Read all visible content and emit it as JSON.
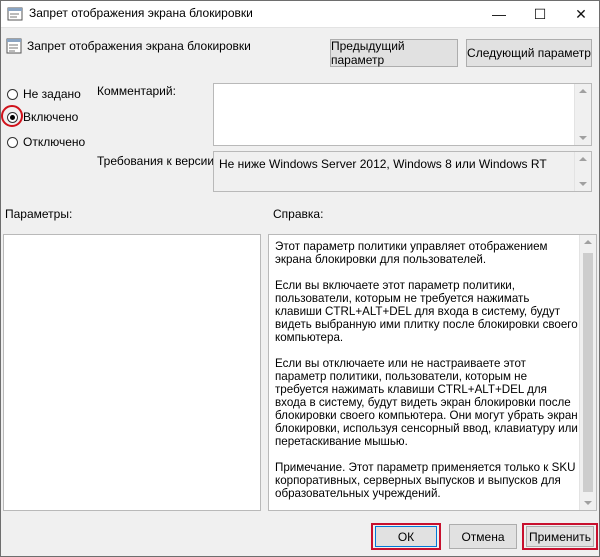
{
  "window": {
    "title": "Запрет отображения экрана блокировки",
    "minimize": "—",
    "maximize": "☐",
    "close": "✕"
  },
  "header": {
    "title": "Запрет отображения экрана блокировки",
    "prev_button": "Предыдущий параметр",
    "next_button": "Следующий параметр"
  },
  "state": {
    "options": [
      "Не задано",
      "Включено",
      "Отключено"
    ],
    "selected": "Включено"
  },
  "comment": {
    "label": "Комментарий:",
    "value": ""
  },
  "requirements": {
    "label": "Требования к версии:",
    "value": "Не ниже Windows Server 2012, Windows 8 или Windows RT"
  },
  "params": {
    "label": "Параметры:"
  },
  "help": {
    "label": "Справка:",
    "paragraphs": [
      "Этот параметр политики управляет отображением экрана блокировки для пользователей.",
      "Если вы включаете этот параметр политики, пользователи, которым не требуется нажимать клавиши CTRL+ALT+DEL для входа в систему, будут видеть выбранную ими плитку после блокировки своего компьютера.",
      "Если вы отключаете или не настраиваете этот параметр политики, пользователи, которым не требуется нажимать клавиши CTRL+ALT+DEL для входа в систему, будут видеть экран блокировки после блокировки своего компьютера. Они могут убрать экран блокировки, используя сенсорный ввод, клавиатуру или перетаскивание мышью.",
      "Примечание. Этот параметр применяется только к SKU корпоративных, серверных выпусков и выпусков для образовательных учреждений."
    ]
  },
  "footer": {
    "ok": "ОК",
    "cancel": "Отмена",
    "apply": "Применить"
  },
  "colors": {
    "highlight_red": "#c8102e",
    "focus_blue": "#0078d7"
  }
}
